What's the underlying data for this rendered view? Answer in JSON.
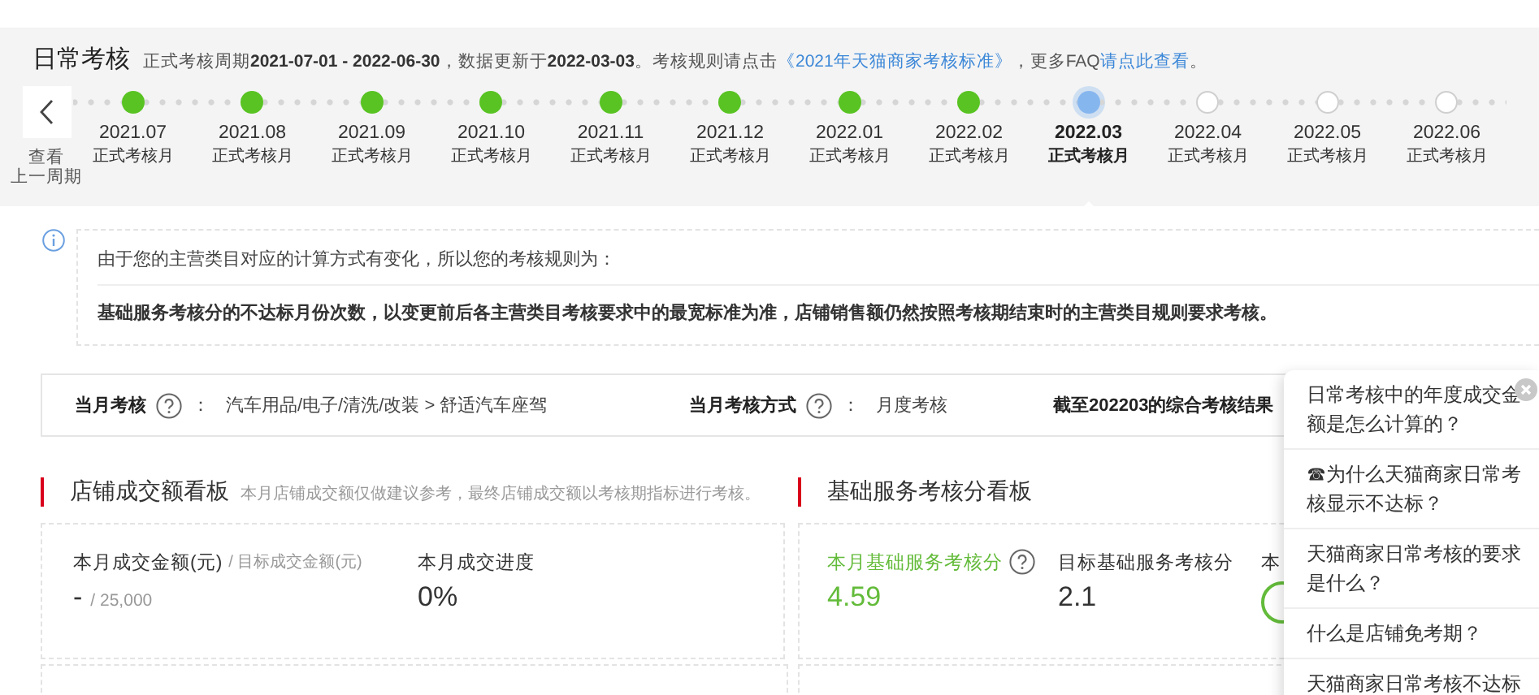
{
  "header": {
    "title": "日常考核",
    "note": [
      {
        "kind": "text",
        "text": "正式考核周期**2021-07-01 - 2022-06-30**，数据更新于**2022-03-03**。考核规则请点击"
      },
      {
        "kind": "link",
        "text": "《2021年天猫商家考核标准》"
      },
      {
        "kind": "text",
        "text": "，更多FAQ"
      },
      {
        "kind": "link",
        "text": "请点此查看"
      },
      {
        "kind": "text",
        "text": "。"
      }
    ]
  },
  "prev_period": {
    "label_lines": [
      "查看",
      "上一周期"
    ]
  },
  "timeline": [
    {
      "month": "2021.07",
      "label": "正式考核月",
      "kind": "done",
      "selected": false
    },
    {
      "month": "2021.08",
      "label": "正式考核月",
      "kind": "done",
      "selected": false
    },
    {
      "month": "2021.09",
      "label": "正式考核月",
      "kind": "done",
      "selected": false
    },
    {
      "month": "2021.10",
      "label": "正式考核月",
      "kind": "done",
      "selected": false
    },
    {
      "month": "2021.11",
      "label": "正式考核月",
      "kind": "done",
      "selected": false
    },
    {
      "month": "2021.12",
      "label": "正式考核月",
      "kind": "done",
      "selected": false
    },
    {
      "month": "2022.01",
      "label": "正式考核月",
      "kind": "done",
      "selected": false
    },
    {
      "month": "2022.02",
      "label": "正式考核月",
      "kind": "done",
      "selected": false
    },
    {
      "month": "2022.03",
      "label": "正式考核月",
      "kind": "current",
      "selected": true
    },
    {
      "month": "2022.04",
      "label": "正式考核月",
      "kind": "future",
      "selected": false
    },
    {
      "month": "2022.05",
      "label": "正式考核月",
      "kind": "future",
      "selected": false
    },
    {
      "month": "2022.06",
      "label": "正式考核月",
      "kind": "future",
      "selected": false
    }
  ],
  "notice": {
    "lines": [
      {
        "text": "由于您的主营类目对应的计算方式有变化，所以您的考核规则为：",
        "bold": false
      },
      {
        "text": "基础服务考核分的不达标月份次数，以变更前后各主营类目考核要求中的最宽标准为准，店铺销售额仍然按照考核期结束时的主营类目规则要求考核。",
        "bold": true
      }
    ]
  },
  "summary": [
    {
      "label": "当月考核",
      "help": true,
      "separator": "：",
      "value": "汽车用品/电子/清洗/改装 > 舒适汽车座驾"
    },
    {
      "label": "当月考核方式",
      "help": true,
      "separator": "：",
      "value": "月度考核"
    },
    {
      "label": "截至202203的综合考核结果"
    }
  ],
  "panels": [
    {
      "title": "店铺成交额看板",
      "note": "本月店铺成交额仅做建议参考，最终店铺成交额以考核期指标进行考核。",
      "metrics": [
        {
          "kind": "number",
          "label": "本月成交金额(元)",
          "sub_label": "/ 目标成交金额(元)",
          "value": "-",
          "sub_value": "/ 25,000",
          "highlight": false
        },
        {
          "kind": "number",
          "label": "本月成交进度",
          "value": "0%",
          "highlight": false
        }
      ]
    },
    {
      "title": "基础服务考核分看板",
      "metrics": [
        {
          "kind": "number",
          "label": "本月基础服务考核分",
          "value": "4.59",
          "highlight": true,
          "help": true
        },
        {
          "kind": "number",
          "label": "目标基础服务考核分",
          "value": "2.1",
          "highlight": false
        },
        {
          "kind": "ring",
          "label": "本",
          "highlight": false
        }
      ]
    }
  ],
  "faq": {
    "items": [
      "日常考核中的年度成交金额是怎么计算的？",
      "☎为什么天猫商家日常考核显示不达标？",
      "天猫商家日常考核的要求是什么？",
      "什么是店铺免考期？",
      "天猫商家日常考核不达标"
    ]
  }
}
